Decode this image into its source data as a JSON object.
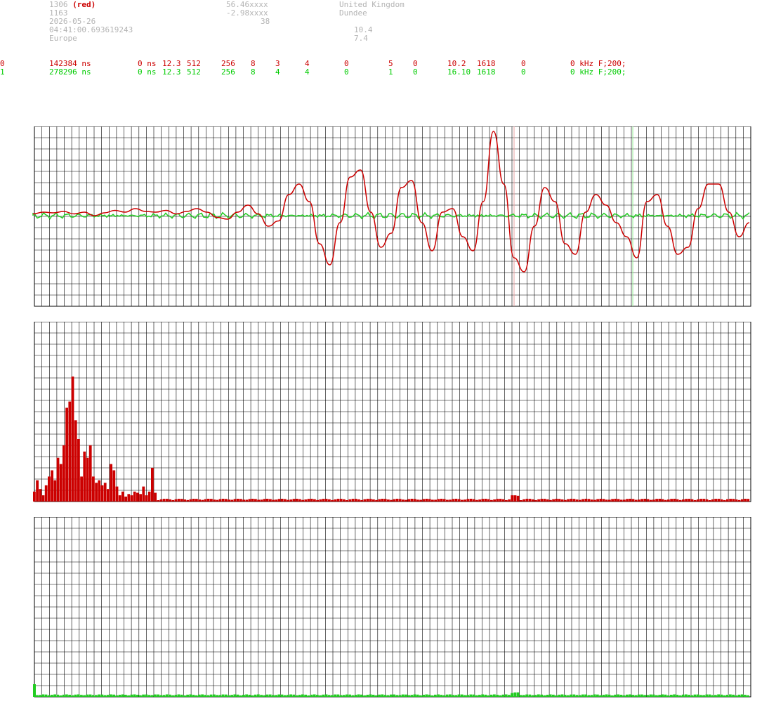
{
  "header": {
    "station_id": "1306",
    "station_color": "(red)",
    "station_num": "1163",
    "date": "2026-05-26",
    "time": "04:41:00.693619243",
    "continent": "Europe",
    "lat": "56.46xxxx",
    "lon": "-2.98xxxx",
    "alt": "38",
    "country": "United Kingdom",
    "city": "Dundee",
    "val1": "10.4",
    "val2": "7.4"
  },
  "channels": [
    {
      "idx": "0",
      "time": "142384 ns",
      "offset": "0 ns",
      "v1": "12.3",
      "v2": "512",
      "v3": "256",
      "v4": "8",
      "v5": "3",
      "v6": "4",
      "v7": "0",
      "v8": "5",
      "v9": "0",
      "v10": "10.2",
      "v11": "1618",
      "v12": "0",
      "freq": "0 kHz",
      "flag": "F;200;"
    },
    {
      "idx": "1",
      "time": "278296 ns",
      "offset": "0 ns",
      "v1": "12.3",
      "v2": "512",
      "v3": "256",
      "v4": "8",
      "v5": "4",
      "v6": "4",
      "v7": "0",
      "v8": "1",
      "v9": "0",
      "v10": "16.10",
      "v11": "1618",
      "v12": "0",
      "freq": "0 kHz",
      "flag": "F;200;"
    }
  ],
  "colors": {
    "ch0": "#cc0000",
    "ch1": "#22cc22",
    "grid": "#000000",
    "text_gray": "#b4b4b4"
  },
  "chart_data": [
    {
      "type": "line",
      "series": [
        {
          "values": [
            0.05,
            0.1,
            0.08,
            0.12,
            0.05,
            0.1,
            0.0,
            0.08,
            0.15,
            0.1,
            0.2,
            0.12,
            0.1,
            0.15,
            0.05,
            0.12,
            0.2,
            0.1,
            -0.05,
            -0.1,
            0.1,
            0.3,
            0.05,
            -0.3,
            -0.15,
            0.6,
            0.9,
            0.4,
            -0.8,
            -1.4,
            -0.2,
            1.1,
            1.3,
            0.1,
            -0.9,
            -0.5,
            0.8,
            1.0,
            -0.2,
            -1.0,
            0.1,
            0.2,
            -0.6,
            -1.0,
            0.4,
            2.4,
            0.9,
            -1.2,
            -1.6,
            -0.3,
            0.8,
            0.4,
            -0.8,
            -1.1,
            0.1,
            0.6,
            0.3,
            -0.2,
            -0.6,
            -1.2,
            0.4,
            0.6,
            -0.3,
            -1.1,
            -0.9,
            0.2,
            0.9,
            0.9,
            0.1,
            -0.6,
            -0.2
          ],
          "x_range": [
            0,
            1
          ]
        },
        {
          "values": [
            0.0,
            0.02,
            -0.02,
            0.03,
            -0.01,
            0.01,
            0.0,
            -0.02,
            0.02,
            0.0
          ],
          "x_range": [
            0,
            1
          ]
        }
      ]
    },
    {
      "type": "bar",
      "values": [
        0.08,
        0.17,
        0.1,
        0.05,
        0.13,
        0.2,
        0.25,
        0.17,
        0.35,
        0.3,
        0.45,
        0.75,
        0.8,
        1.0,
        0.65,
        0.5,
        0.2,
        0.4,
        0.35,
        0.45,
        0.2,
        0.15,
        0.17,
        0.13,
        0.15,
        0.1,
        0.3,
        0.25,
        0.12,
        0.05,
        0.08,
        0.04,
        0.06,
        0.05,
        0.08,
        0.07,
        0.06,
        0.12,
        0.05,
        0.08,
        0.27,
        0.07
      ]
    },
    {
      "type": "bar",
      "values": [
        0.1,
        0.02,
        0.01
      ]
    }
  ]
}
